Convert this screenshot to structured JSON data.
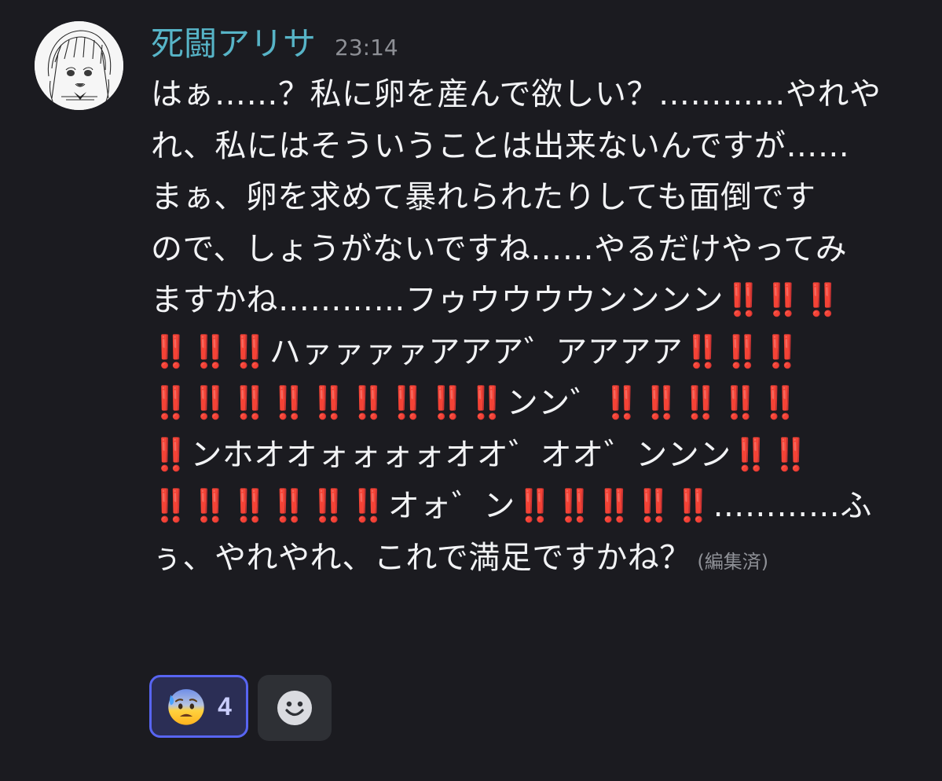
{
  "message": {
    "author": "死闘アリサ",
    "timestamp": "23:14",
    "lines": [
      [
        {
          "t": "はぁ……？私に卵を産んで欲しい？…………やれや"
        }
      ],
      [
        {
          "t": "れ、私にはそういうことは出来ないんですが……"
        }
      ],
      [
        {
          "t": "まぁ、卵を求めて暴れられたりしても面倒です"
        }
      ],
      [
        {
          "t": "ので、しょうがないですね……やるだけやってみ"
        }
      ],
      [
        {
          "t": "ますかね…………フゥウウウウンンンン"
        },
        {
          "t": "‼️‼️‼️",
          "bang": true
        }
      ],
      [
        {
          "t": "‼️‼️‼️",
          "bang": true
        },
        {
          "t": "ハァァァァアアア゛アアアア"
        },
        {
          "t": "‼️‼️‼️",
          "bang": true
        }
      ],
      [
        {
          "t": "‼️‼️‼️‼️‼️‼️‼️‼️‼️",
          "bang": true
        },
        {
          "t": "ンン゛"
        },
        {
          "t": "‼️‼️‼️‼️‼️",
          "bang": true
        }
      ],
      [
        {
          "t": "‼️",
          "bang": true
        },
        {
          "t": "ンホオオォォォォオオ゛オオ゛ンンン"
        },
        {
          "t": "‼️‼️",
          "bang": true
        }
      ],
      [
        {
          "t": "‼️‼️‼️‼️‼️‼️",
          "bang": true
        },
        {
          "t": "オォ゛ン"
        },
        {
          "t": "‼️‼️‼️‼️‼️",
          "bang": true
        },
        {
          "t": "…………ふ"
        }
      ],
      [
        {
          "t": "ぅ、やれやれ、これで満足ですかね？"
        },
        {
          "t": " (編集済)",
          "edited": true
        }
      ]
    ]
  },
  "reactions": [
    {
      "emoji": "anxious-face-with-sweat",
      "count": "4",
      "selected": true
    }
  ],
  "add_reaction_icon": "smiley-face-icon",
  "colors": {
    "background": "#1b1b20",
    "username": "#57b4c7",
    "timestamp": "#8e9096",
    "text": "#f2f3f5",
    "double_exclamation": "#e0242b",
    "reaction_border": "#5865f2",
    "reaction_bg": "#2b2e55"
  }
}
